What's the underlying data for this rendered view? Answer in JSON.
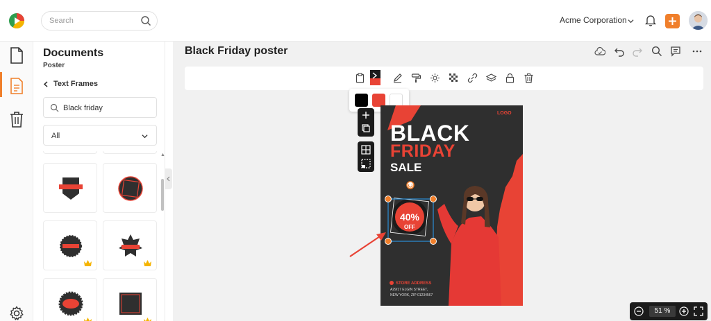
{
  "header": {
    "search_placeholder": "Search",
    "organization": "Acme Corporation"
  },
  "panel": {
    "title": "Documents",
    "subtitle": "Poster",
    "back_label": "Text Frames",
    "search_value": "Black friday",
    "filter_value": "All",
    "thumbnails": [
      {
        "shape": "shield-banner",
        "premium": false
      },
      {
        "shape": "circle-frame",
        "premium": false
      },
      {
        "shape": "round-ribbon",
        "premium": true
      },
      {
        "shape": "star-ribbon",
        "premium": true
      },
      {
        "shape": "seal-ribbon",
        "premium": true
      },
      {
        "shape": "square-frame",
        "premium": true
      }
    ]
  },
  "document": {
    "title": "Black Friday poster",
    "swatch_colors": [
      "#000000",
      "#e84335",
      "#ffffff"
    ]
  },
  "poster": {
    "logo": "LOGO",
    "line1": "BLACK",
    "line2": "FRIDAY",
    "line3": "SALE",
    "badge_value": "40%",
    "badge_sub": "OFF",
    "store_label": "STORE ADDRESS",
    "address_line1": "A29/17 ELGIN STREET,",
    "address_line2": "NEW YORK, ZIP 01234567",
    "accent": "#e84335"
  },
  "zoom": {
    "value": "51 %"
  },
  "colors": {
    "brand_orange": "#f07f2b",
    "poster_bg": "#2f2f2f",
    "poster_red": "#e84335",
    "selection_blue": "#2b8fd8"
  }
}
